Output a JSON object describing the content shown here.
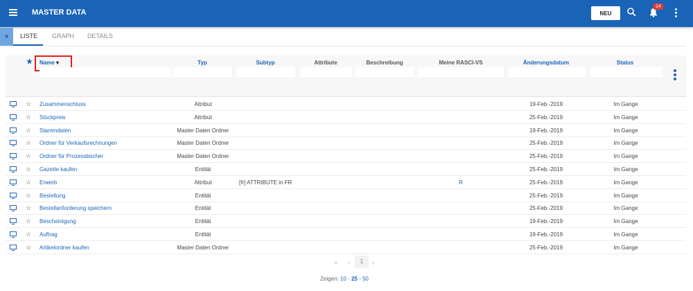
{
  "header": {
    "title": "MASTER DATA",
    "new_label": "NEU",
    "notification_count": "14"
  },
  "tabs": [
    "LISTE",
    "GRAPH",
    "DETAILS"
  ],
  "columns": {
    "name": "Name",
    "typ": "Typ",
    "subtyp": "Subtyp",
    "attribute": "Attribute",
    "beschreibung": "Beschreibung",
    "rasci": "Meine RASCI-VS",
    "datum": "Änderungsdatum",
    "status": "Status"
  },
  "rows": [
    {
      "name": "Zusammenschluss",
      "typ": "Attribut",
      "subtyp": "",
      "rasci": "",
      "datum": "19-Feb.-2019",
      "status": "Im Gange"
    },
    {
      "name": "Stückpreis",
      "typ": "Attribut",
      "subtyp": "",
      "rasci": "",
      "datum": "25-Feb.-2019",
      "status": "Im Gange"
    },
    {
      "name": "Stammdaten",
      "typ": "Master Daten Ordner",
      "subtyp": "",
      "rasci": "",
      "datum": "19-Feb.-2019",
      "status": "Im Gange"
    },
    {
      "name": "Ordner für Verkaufsrechnungen",
      "typ": "Master Daten Ordner",
      "subtyp": "",
      "rasci": "",
      "datum": "25-Feb.-2019",
      "status": "Im Gange"
    },
    {
      "name": "Ordner für Prozessbücher",
      "typ": "Master Daten Ordner",
      "subtyp": "",
      "rasci": "",
      "datum": "25-Feb.-2019",
      "status": "Im Gange"
    },
    {
      "name": "Gazette kaufen",
      "typ": "Entität",
      "subtyp": "",
      "rasci": "",
      "datum": "25-Feb.-2019",
      "status": "Im Gange"
    },
    {
      "name": "Erwerb",
      "typ": "Attribut",
      "subtyp": "[fr] ATTRIBUTE in FR",
      "rasci": "R",
      "datum": "25-Feb.-2019",
      "status": "Im Gange"
    },
    {
      "name": "Bestellung",
      "typ": "Entität",
      "subtyp": "",
      "rasci": "",
      "datum": "25-Feb.-2019",
      "status": "Im Gange"
    },
    {
      "name": "Bestellanforderung speichern",
      "typ": "Entität",
      "subtyp": "",
      "rasci": "",
      "datum": "25-Feb.-2019",
      "status": "Im Gange"
    },
    {
      "name": "Bescheinigung",
      "typ": "Entität",
      "subtyp": "",
      "rasci": "",
      "datum": "19-Feb.-2019",
      "status": "Im Gange"
    },
    {
      "name": "Auftrag",
      "typ": "Entität",
      "subtyp": "",
      "rasci": "",
      "datum": "19-Feb.-2019",
      "status": "Im Gange"
    },
    {
      "name": "Artikelordner kaufen",
      "typ": "Master Daten Ordner",
      "subtyp": "",
      "rasci": "",
      "datum": "25-Feb.-2019",
      "status": "Im Gange"
    }
  ],
  "pagination": {
    "first": "«",
    "prev": "‹",
    "page": "1",
    "next": "›",
    "show_label": "Zeigen:",
    "sizes": [
      "10",
      "25",
      "50"
    ],
    "selected_size": "25"
  }
}
